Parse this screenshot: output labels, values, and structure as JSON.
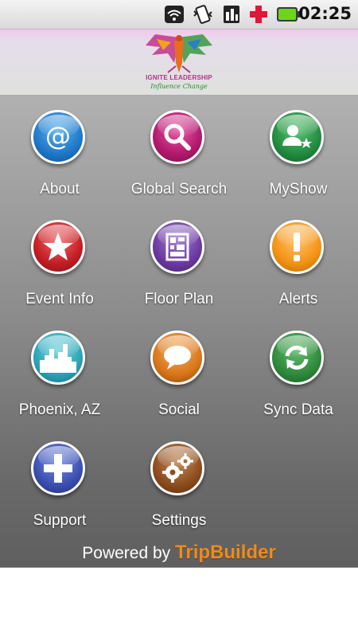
{
  "status_bar": {
    "time": "02:25",
    "icons": [
      "wifi-icon",
      "vibrate-icon",
      "sim-icon",
      "plus-icon",
      "battery-icon"
    ]
  },
  "banner": {
    "logo_title": "IGNITE LEADERSHIP",
    "logo_tagline": "Influence Change"
  },
  "menu": {
    "items": [
      {
        "label": "About",
        "icon": "at-icon",
        "color": "#1f78c8"
      },
      {
        "label": "Global Search",
        "icon": "search-icon",
        "color": "#b3196e"
      },
      {
        "label": "MyShow",
        "icon": "person-star-icon",
        "color": "#218c3f"
      },
      {
        "label": "Event Info",
        "icon": "star-icon",
        "color": "#c31d24"
      },
      {
        "label": "Floor Plan",
        "icon": "floor-plan-icon",
        "color": "#6b3aa0"
      },
      {
        "label": "Alerts",
        "icon": "exclamation-icon",
        "color": "#f39214"
      },
      {
        "label": "Phoenix, AZ",
        "icon": "city-skyline-icon",
        "color": "#2aa3b5"
      },
      {
        "label": "Social",
        "icon": "speech-bubble-icon",
        "color": "#d8761a"
      },
      {
        "label": "Sync Data",
        "icon": "sync-icon",
        "color": "#2f8a3c"
      },
      {
        "label": "Support",
        "icon": "plus-icon",
        "color": "#3b4fb0"
      },
      {
        "label": "Settings",
        "icon": "gears-icon",
        "color": "#8c4c1d"
      }
    ]
  },
  "footer": {
    "powered_by": "Powered by",
    "brand": "TripBuilder"
  }
}
